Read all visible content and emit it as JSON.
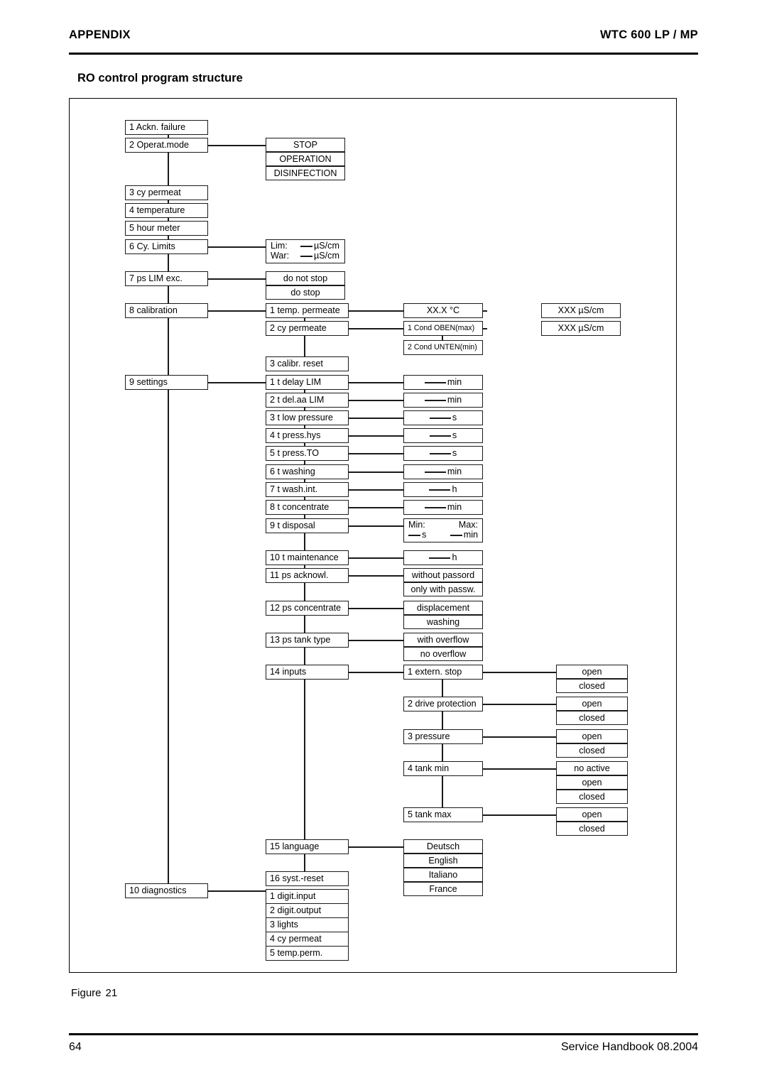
{
  "header": {
    "left": "APPENDIX",
    "right": "WTC 600 LP / MP"
  },
  "section_title": "RO control program structure",
  "figure": {
    "caption_label": "Figure",
    "caption_number": "21"
  },
  "footer": {
    "page_number": "64",
    "right": "Service Handbook 08.2004"
  },
  "diagram": {
    "main_menu": [
      {
        "label": "1 Ackn. failure"
      },
      {
        "label": "2 Operat.mode"
      },
      {
        "label": "3 cy permeat"
      },
      {
        "label": "4 temperature"
      },
      {
        "label": "5 hour meter"
      },
      {
        "label": "6 Cy. Limits"
      },
      {
        "label": "7 ps LIM exc."
      },
      {
        "label": "8 calibration"
      },
      {
        "label": "9 settings"
      },
      {
        "label": "10 diagnostics"
      }
    ],
    "operat_mode_options": [
      "STOP",
      "OPERATION",
      "DISINFECTION"
    ],
    "cy_limits": {
      "lim_key": "Lim:",
      "lim_value": "µS/cm",
      "war_key": "War:",
      "war_value": "µS/cm"
    },
    "ps_lim_exc_options": [
      "do not stop",
      "do stop"
    ],
    "calibration": {
      "items": [
        "1 temp. permeate",
        "2 cy permeate",
        "3 calibr. reset"
      ],
      "temp_permeate_value": "XX.X °C",
      "temp_permeate_value2": "XXX µS/cm",
      "cy_permeate_sub": [
        "1 Cond OBEN(max)",
        "2 Cond UNTEN(min)"
      ],
      "cy_permeate_value": "XXX µS/cm"
    },
    "settings": {
      "items": [
        {
          "label": "1 t delay LIM",
          "value_unit": "min"
        },
        {
          "label": "2 t del.aa LIM",
          "value_unit": "min"
        },
        {
          "label": "3 t low pressure",
          "value_unit": "s"
        },
        {
          "label": "4 t press.hys",
          "value_unit": "s"
        },
        {
          "label": "5 t press.TO",
          "value_unit": "s"
        },
        {
          "label": "6 t washing",
          "value_unit": "min"
        },
        {
          "label": "7 t wash.int.",
          "value_unit": "h"
        },
        {
          "label": "8 t concentrate",
          "value_unit": "min"
        },
        {
          "label": "9 t disposal",
          "value_unit": ""
        },
        {
          "label": "10 t maintenance",
          "value_unit": "h"
        },
        {
          "label": "11 ps acknowl.",
          "value_unit": ""
        },
        {
          "label": "12 ps concentrate",
          "value_unit": ""
        },
        {
          "label": "13 ps tank type",
          "value_unit": ""
        },
        {
          "label": "14 inputs",
          "value_unit": ""
        },
        {
          "label": "15 language",
          "value_unit": ""
        },
        {
          "label": "16 syst.-reset",
          "value_unit": ""
        }
      ],
      "disposal": {
        "min_label": "Min:",
        "max_label": "Max:",
        "min_unit": "s",
        "max_unit": "min"
      },
      "ps_acknowl_options": [
        "without passord",
        "only with passw."
      ],
      "ps_concentrate_options": [
        "displacement",
        "washing"
      ],
      "ps_tank_type_options": [
        "with overflow",
        "no overflow"
      ],
      "language_options": [
        "Deutsch",
        "English",
        "Italiano",
        "France"
      ]
    },
    "inputs": [
      {
        "label": "1 extern. stop",
        "options": [
          "open",
          "closed"
        ]
      },
      {
        "label": "2 drive protection",
        "options": [
          "open",
          "closed"
        ]
      },
      {
        "label": "3 pressure",
        "options": [
          "open",
          "closed"
        ]
      },
      {
        "label": "4 tank min",
        "options": [
          "no active",
          "open",
          "closed"
        ]
      },
      {
        "label": "5 tank max",
        "options": [
          "open",
          "closed"
        ]
      }
    ],
    "diagnostics": [
      "1 digit.input",
      "2 digit.output",
      "3 lights",
      "4 cy permeat",
      "5 temp.perm."
    ]
  }
}
